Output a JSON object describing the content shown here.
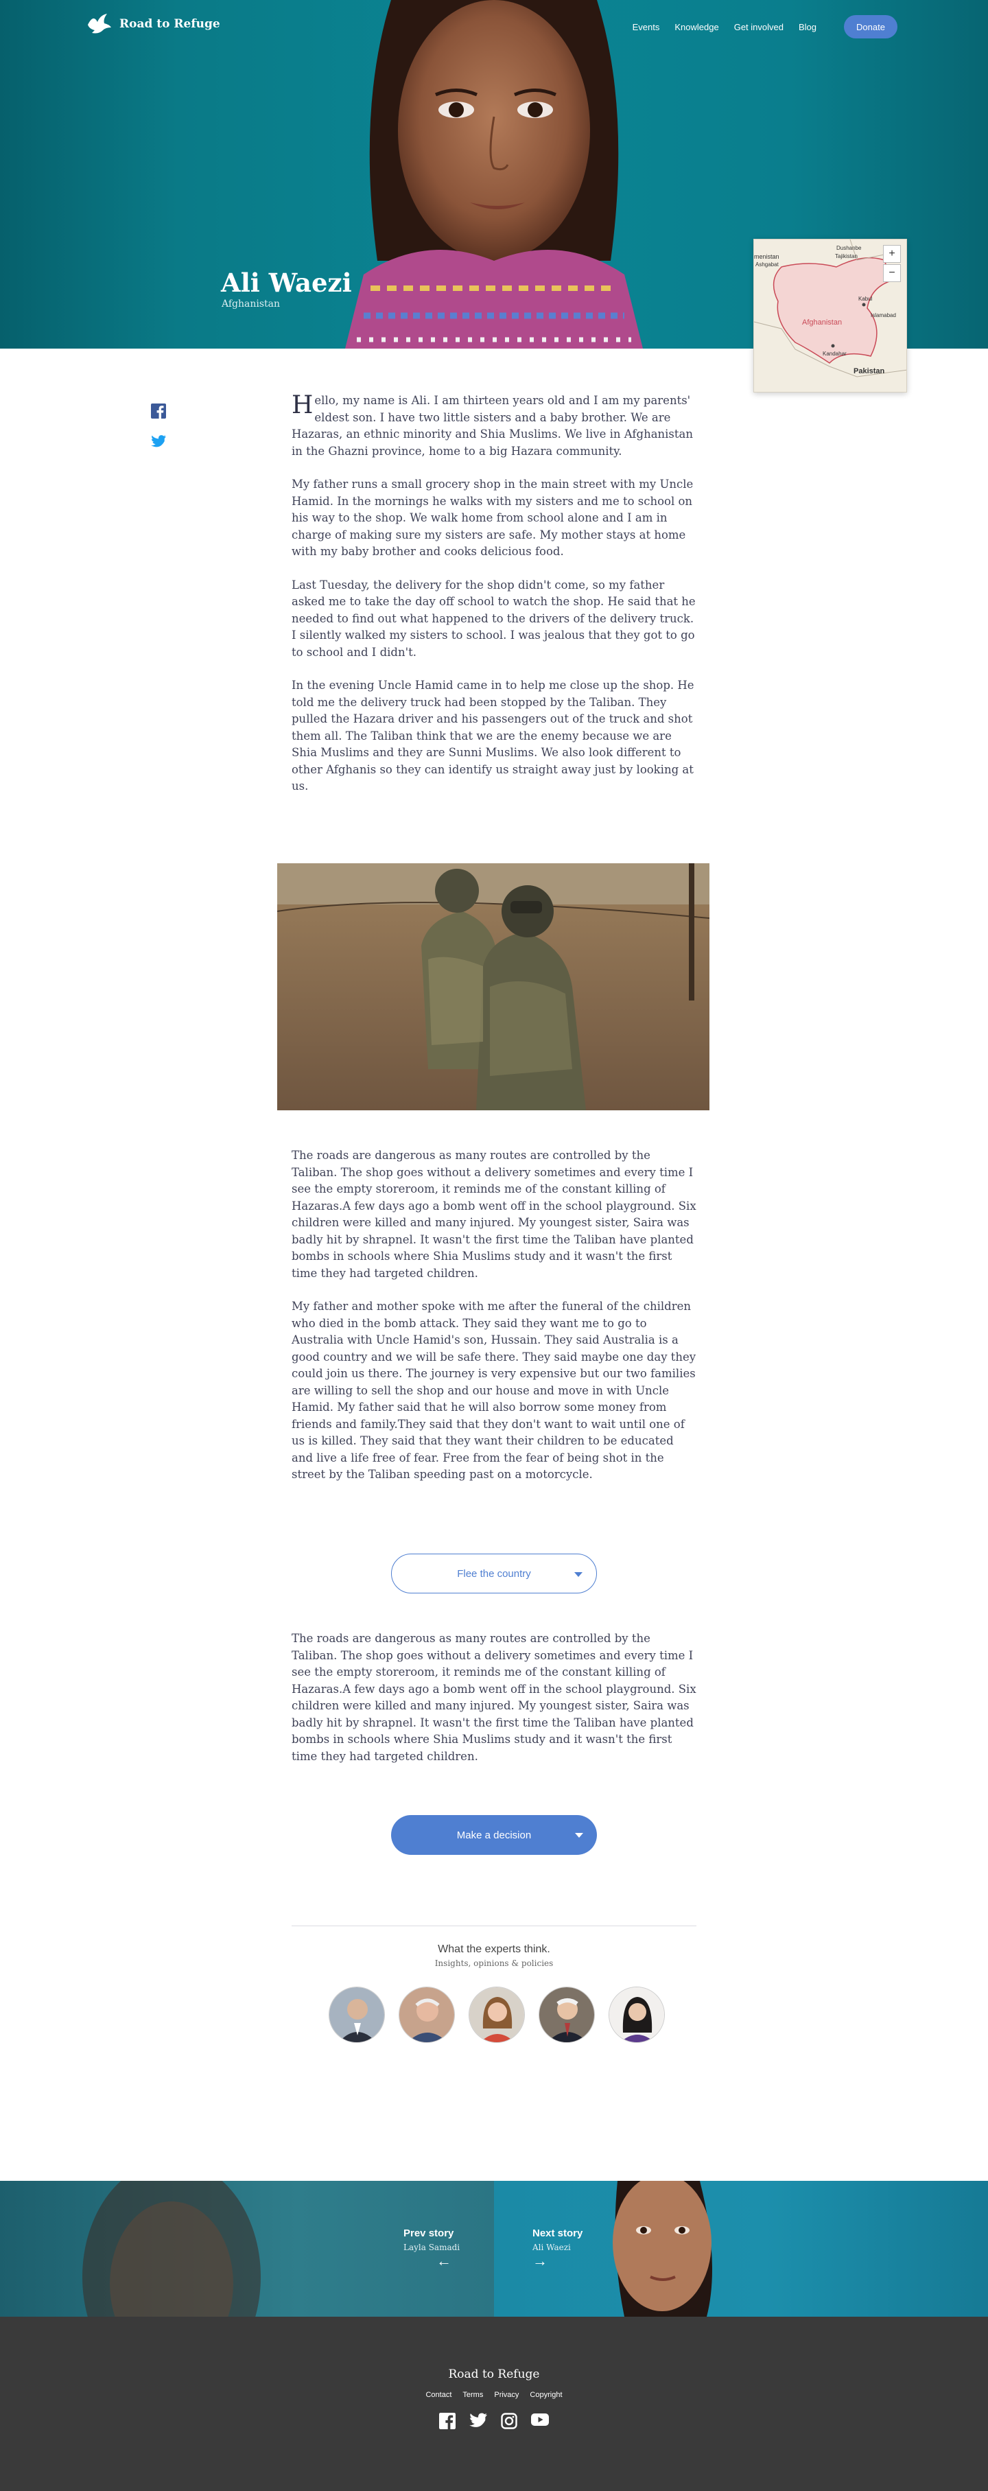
{
  "brand": {
    "name": "Road to Refuge"
  },
  "nav": {
    "links": [
      "Events",
      "Knowledge",
      "Get involved",
      "Blog"
    ],
    "donate_label": "Donate"
  },
  "hero": {
    "name": "Ali Waezi",
    "country": "Afghanistan"
  },
  "map": {
    "zoom_in": "+",
    "zoom_out": "−",
    "labels": {
      "country": "Afghanistan",
      "pakistan": "Pakistan",
      "top_left": "menistan",
      "top_left_city": "Ashgabat",
      "top_right_a": "Dushanbe",
      "top_right_b": "Tajikistan",
      "kabul": "Kabul",
      "islamabad": "Islamabad",
      "kandahar": "Kandahar"
    }
  },
  "share": {
    "facebook_icon": "facebook-icon",
    "twitter_icon": "twitter-icon"
  },
  "article": {
    "intro_dropcap": "H",
    "intro_rest": "ello, my name is Ali. I am thirteen years old and I am my parents' eldest son. I have two little sisters and a baby brother. We are Hazaras, an ethnic minority and Shia Muslims. We live in Afghanistan in the Ghazni province, home to a big Hazara community.",
    "p2": "My father runs a small grocery shop in the main street with my Uncle Hamid. In the mornings he walks with my sisters and me to school on his way to the shop. We walk home from school alone and I am in charge of making sure my sisters are safe. My mother stays at home with my baby brother and cooks delicious food.",
    "p3": "Last Tuesday, the delivery for the shop didn't come, so my father asked me to take the day off school to watch the shop. He said that he needed to find out what happened to the drivers of the delivery truck. I silently walked my sisters to school. I was jealous that they got to go to school and I didn't.",
    "p4": "In the evening Uncle Hamid came in to help me close up the shop. He told me the delivery truck had been stopped by the Taliban. They pulled the Hazara driver and his passengers out of the truck and shot them all. The Taliban think that we are the enemy because we are Shia Muslims and they are Sunni Muslims. We also look different to other Afghanis so they can identify us straight away just by looking at us.",
    "p5": "The roads are dangerous as many routes are controlled by the Taliban. The shop goes without a delivery sometimes and every time I see the empty storeroom, it reminds me of the constant killing of Hazaras.A few days ago a bomb went off in the school playground. Six children were killed and many injured. My youngest sister, Saira was badly hit by shrapnel. It wasn't the first time the Taliban have planted bombs in schools where Shia Muslims study and it wasn't the first time they had targeted children.",
    "p6": "My father and mother spoke with me after the funeral of the children who died in the bomb attack. They said they want me to go to Australia with Uncle Hamid's son, Hussain. They said Australia is a good country and we will be safe there. They said maybe one day they could join us there. The journey is very expensive but our two families are willing to sell the shop and our house and move in with Uncle Hamid. My father said that he will also borrow some money from friends and family.They said that they don't want to wait until one of us is killed. They said that they want their children to be educated and live a life free of fear. Free from the fear of being shot in the street by the Taliban speeding past on a motorcycle.",
    "p7": "The roads are dangerous as many routes are controlled by the Taliban. The shop goes without a delivery sometimes and every time I see the empty storeroom, it reminds me of the constant killing of Hazaras.A few days ago a bomb went off in the school playground. Six children were killed and many injured. My youngest sister, Saira was badly hit by shrapnel. It wasn't the first time the Taliban have planted bombs in schools where Shia Muslims study and it wasn't the first time they had targeted children."
  },
  "choices": {
    "flee": "Flee the country",
    "decision": "Make a decision"
  },
  "experts": {
    "title": "What the experts think.",
    "subtitle": "Insights, opinions & policies"
  },
  "story_nav": {
    "prev_label": "Prev story",
    "prev_name": "Layla Samadi",
    "next_label": "Next story",
    "next_name": "Ali Waezi",
    "prev_arrow": "←",
    "next_arrow": "→"
  },
  "footer": {
    "title": "Road to Refuge",
    "links": [
      "Contact",
      "Terms",
      "Privacy",
      "Copyright"
    ],
    "social_icons": [
      "facebook-icon",
      "twitter-icon",
      "instagram-icon",
      "youtube-icon"
    ]
  },
  "colors": {
    "accent": "#4f7fd1",
    "hero_teal": "#0b8594",
    "footer_bg": "#3a3a3a"
  }
}
